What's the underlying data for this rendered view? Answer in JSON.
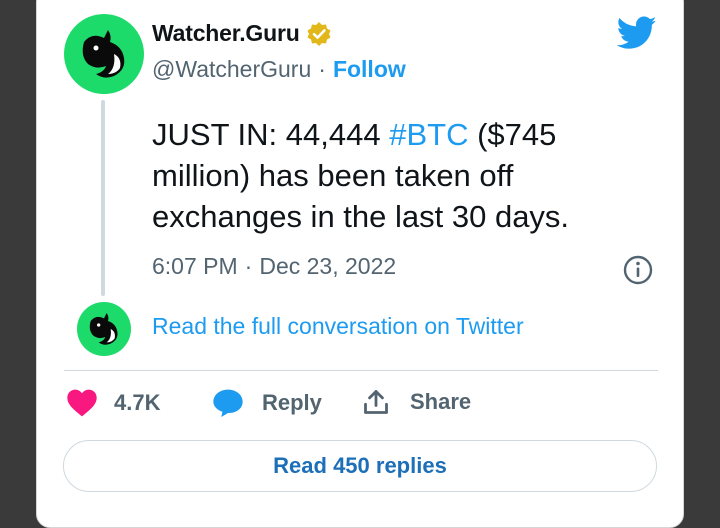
{
  "author": {
    "display_name": "Watcher.Guru",
    "handle": "@WatcherGuru",
    "separator": "·",
    "follow_label": "Follow"
  },
  "tweet": {
    "text_before": "JUST IN: 44,444 ",
    "hashtag": "#BTC",
    "text_after": " ($745 million) has been taken off exchanges in the last 30 days.",
    "time": "6:07 PM",
    "separator": "·",
    "date": "Dec 23, 2022"
  },
  "conversation_link": "Read the full conversation on Twitter",
  "actions": {
    "like_count": "4.7K",
    "reply_label": "Reply",
    "share_label": "Share"
  },
  "replies_button": "Read 450 replies",
  "icons": {
    "avatar": "orca-logo-icon",
    "verified": "verified-badge-icon",
    "brand": "twitter-bird-icon",
    "info": "info-icon",
    "like": "heart-icon",
    "reply": "speech-bubble-icon",
    "share": "upload-share-icon"
  },
  "colors": {
    "accent": "#1d9bf0",
    "avatar_bg": "#1ddb6a",
    "like": "#f91880",
    "verified": "#e2b719"
  }
}
